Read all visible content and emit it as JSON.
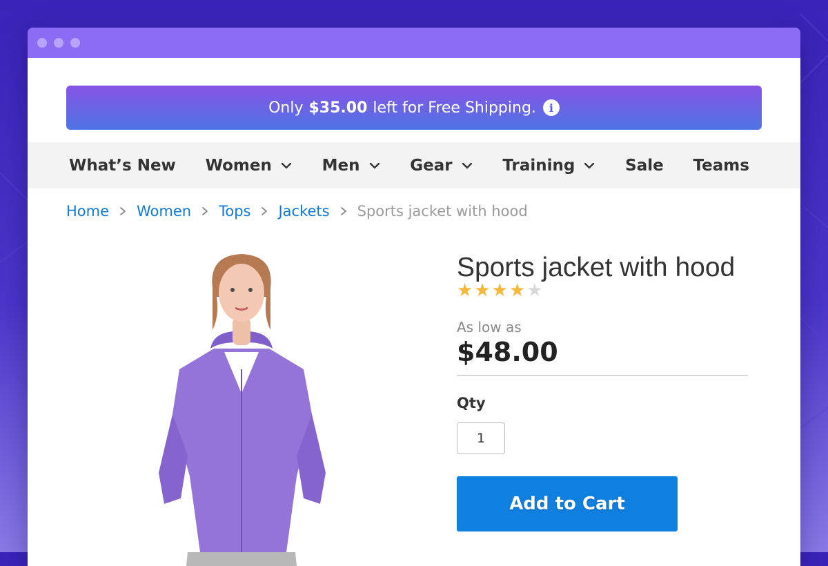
{
  "promo": {
    "prefix": "Only",
    "amount": "$35.00",
    "suffix": "left for Free Shipping.",
    "icon": "info-icon"
  },
  "nav": {
    "items": [
      {
        "label": "What’s New",
        "has_dropdown": false
      },
      {
        "label": "Women",
        "has_dropdown": true
      },
      {
        "label": "Men",
        "has_dropdown": true
      },
      {
        "label": "Gear",
        "has_dropdown": true
      },
      {
        "label": "Training",
        "has_dropdown": true
      },
      {
        "label": "Sale",
        "has_dropdown": false
      },
      {
        "label": "Teams",
        "has_dropdown": false
      }
    ]
  },
  "breadcrumb": {
    "items": [
      "Home",
      "Women",
      "Tops",
      "Jackets"
    ],
    "current": "Sports jacket with hood"
  },
  "product": {
    "title": "Sports jacket with hood",
    "rating": 4,
    "rating_max": 5,
    "price_label": "As low as",
    "price": "$48.00",
    "qty_label": "Qty",
    "qty_value": "1",
    "add_to_cart": "Add to Cart"
  },
  "colors": {
    "accent": "#0f7fe0",
    "titlebar": "#8b6cf3",
    "star": "#f6b838",
    "link": "#0f7ad8"
  }
}
